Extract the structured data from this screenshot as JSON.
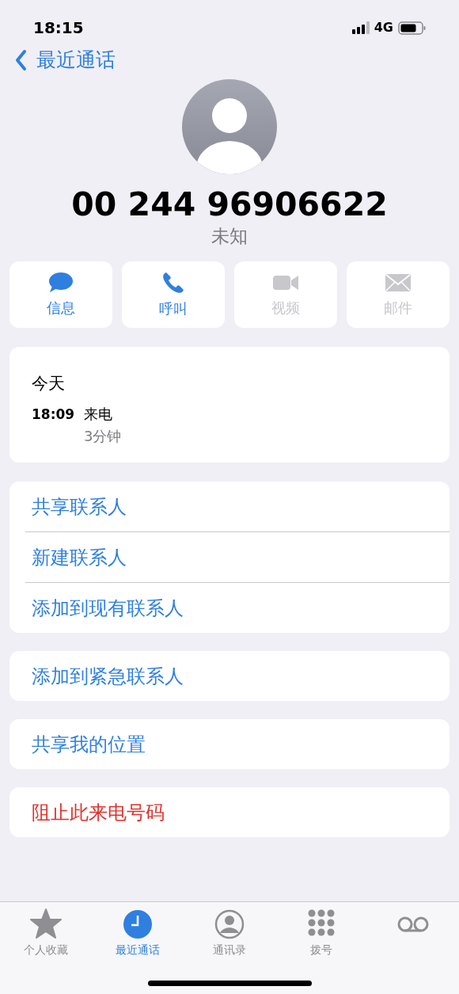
{
  "status_bar": {
    "time": "18:15",
    "network": "4G"
  },
  "nav": {
    "back_label": "最近通话"
  },
  "contact": {
    "number": "00 244 96906622",
    "label": "未知"
  },
  "actions": [
    {
      "kind": "message",
      "label": "信息",
      "disabled": false
    },
    {
      "kind": "phone",
      "label": "呼叫",
      "disabled": false
    },
    {
      "kind": "video",
      "label": "视频",
      "disabled": true
    },
    {
      "kind": "mail",
      "label": "邮件",
      "disabled": true
    }
  ],
  "call_log": {
    "day": "今天",
    "entries": [
      {
        "time": "18:09",
        "type": "来电",
        "duration": "3分钟"
      }
    ]
  },
  "option_groups": [
    [
      {
        "label": "共享联系人",
        "destructive": false
      },
      {
        "label": "新建联系人",
        "destructive": false
      },
      {
        "label": "添加到现有联系人",
        "destructive": false
      }
    ],
    [
      {
        "label": "添加到紧急联系人",
        "destructive": false
      }
    ],
    [
      {
        "label": "共享我的位置",
        "destructive": false
      }
    ],
    [
      {
        "label": "阻止此来电号码",
        "destructive": true
      }
    ]
  ],
  "tab_bar": [
    {
      "kind": "favorites",
      "label": "个人收藏",
      "selected": false
    },
    {
      "kind": "recents",
      "label": "最近通话",
      "selected": true
    },
    {
      "kind": "contacts",
      "label": "通讯录",
      "selected": false
    },
    {
      "kind": "keypad",
      "label": "拨号",
      "selected": false
    },
    {
      "kind": "voicemail",
      "selected": false
    }
  ]
}
